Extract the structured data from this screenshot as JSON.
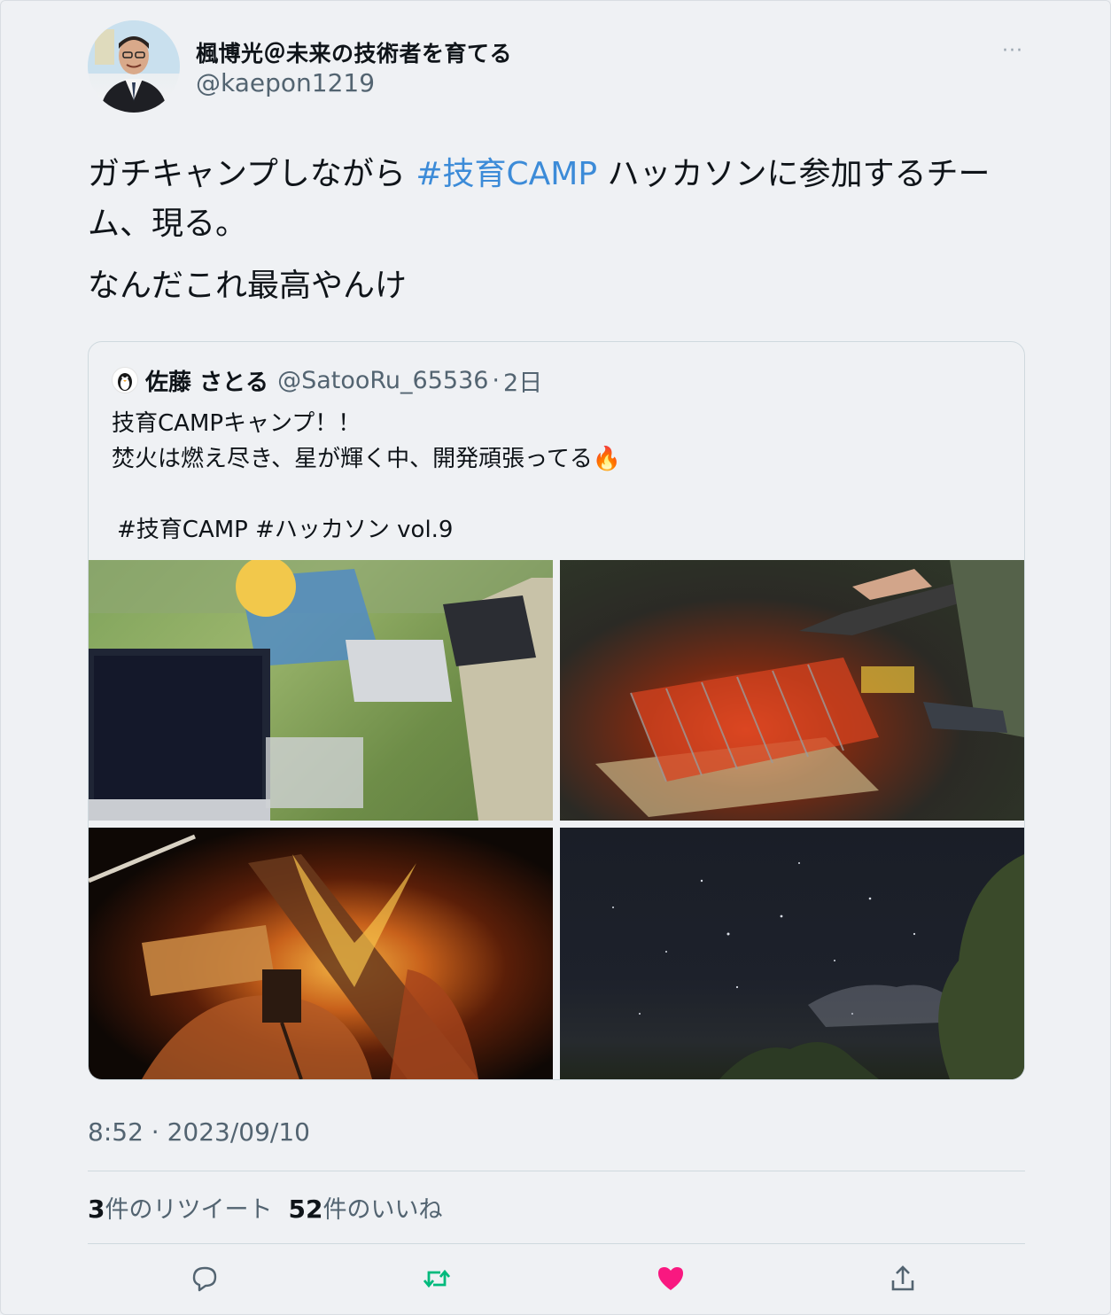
{
  "tweet": {
    "display_name": "楓博光＠未来の技術者を育てる",
    "handle": "@kaepon1219",
    "body_prefix": "ガチキャンプしながら ",
    "hashtag": "#技育CAMP",
    "body_suffix": " ハッカソンに参加するチーム、現る。",
    "body_line2": "なんだこれ最高やんけ",
    "timestamp": "8:52 · 2023/09/10",
    "retweet_count": "3",
    "retweet_label": "件のリツイート",
    "like_count": "52",
    "like_label": "件のいいね",
    "more_label": "···"
  },
  "quote": {
    "display_name": "佐藤 さとる",
    "handle": "@SatooRu_65536",
    "separator": "·",
    "date": "2日",
    "line1": "技育CAMPキャンプ！！",
    "line2": "焚火は燃え尽き、星が輝く中、開発頑張ってる🔥",
    "tags": "#技育CAMP #ハッカソン vol.9",
    "photos": [
      "laptop-camp-photo",
      "grill-photo",
      "campfire-photo",
      "night-sky-photo"
    ]
  },
  "colors": {
    "hashtag": "#3c8bd8",
    "retweet": "#00ba7c",
    "like": "#f91880",
    "secondary": "#536471"
  },
  "icons": [
    "reply-icon",
    "retweet-icon",
    "like-icon",
    "share-icon",
    "more-icon"
  ]
}
